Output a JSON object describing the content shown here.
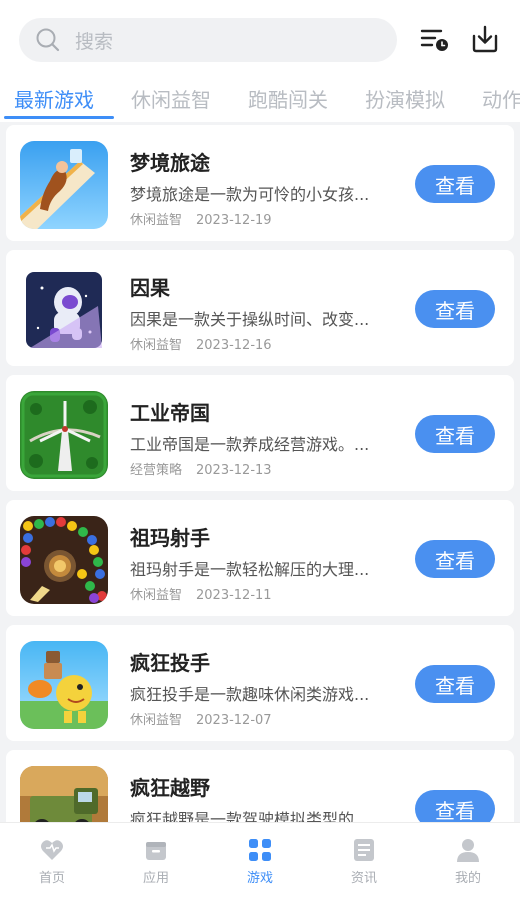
{
  "search": {
    "placeholder": "搜索"
  },
  "header_icons": [
    "history-list-icon",
    "download-icon"
  ],
  "tabs": [
    "最新游戏",
    "休闲益智",
    "跑酷闯关",
    "扮演模拟",
    "动作"
  ],
  "active_tab": 0,
  "accent_color": "#3e8ef7",
  "games": [
    {
      "title": "梦境旅途",
      "desc": "梦境旅途是一款为可怜的小女孩...",
      "category": "休闲益智",
      "date": "2023-12-19",
      "button": "查看"
    },
    {
      "title": "因果",
      "desc": "因果是一款关于操纵时间、改变...",
      "category": "休闲益智",
      "date": "2023-12-16",
      "button": "查看"
    },
    {
      "title": "工业帝国",
      "desc": "工业帝国是一款养成经营游戏。...",
      "category": "经营策略",
      "date": "2023-12-13",
      "button": "查看"
    },
    {
      "title": "祖玛射手",
      "desc": "祖玛射手是一款轻松解压的大理...",
      "category": "休闲益智",
      "date": "2023-12-11",
      "button": "查看"
    },
    {
      "title": "疯狂投手",
      "desc": "疯狂投手是一款趣味休闲类游戏...",
      "category": "休闲益智",
      "date": "2023-12-07",
      "button": "查看"
    },
    {
      "title": "疯狂越野",
      "desc": "疯狂越野是一款驾驶模拟类型的...",
      "category": "",
      "date": "",
      "button": "查看"
    }
  ],
  "bottom_nav": [
    {
      "label": "首页",
      "icon": "heart-home-icon"
    },
    {
      "label": "应用",
      "icon": "app-box-icon"
    },
    {
      "label": "游戏",
      "icon": "game-grid-icon"
    },
    {
      "label": "资讯",
      "icon": "news-doc-icon"
    },
    {
      "label": "我的",
      "icon": "user-icon"
    }
  ],
  "active_nav": 2
}
